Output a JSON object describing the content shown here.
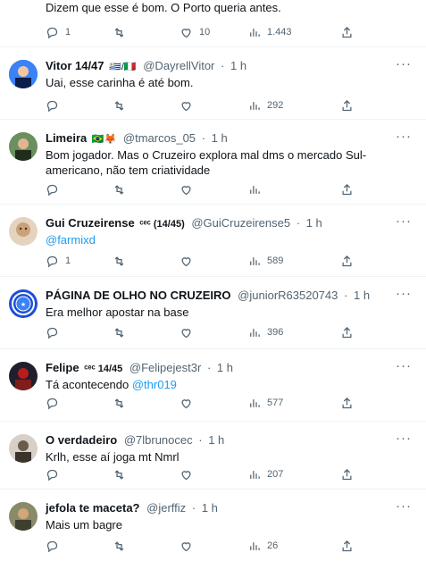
{
  "tweets": [
    {
      "name": "",
      "badge": "",
      "handle": "",
      "time": "",
      "text": "Dizem que esse é bom. O Porto queria antes.",
      "text_link": "",
      "replies": "1",
      "retweets": "",
      "likes": "10",
      "views": "1.443",
      "avatar_color": "#1e3a8a"
    },
    {
      "name": "Vitor 14/47",
      "badge": "🇺🇾/🇮🇹",
      "handle": "@DayrellVitor",
      "time": "1 h",
      "text": "Uai, esse carinha é até bom.",
      "text_link": "",
      "replies": "",
      "retweets": "",
      "likes": "",
      "views": "292",
      "avatar_color": "#2563eb"
    },
    {
      "name": "Limeira",
      "badge": "🇧🇷🦊",
      "handle": "@tmarcos_05",
      "time": "1 h",
      "text": "Bom jogador. Mas o Cruzeiro explora mal dms o mercado Sul-americano, não tem criatividade",
      "text_link": "",
      "replies": "",
      "retweets": "",
      "likes": "",
      "views": "",
      "avatar_color": "#3f6e3a"
    },
    {
      "name": "Gui Cruzeirense",
      "badge": "ᶜᵉᶜ (14/45)",
      "handle": "@GuiCruzeirense5",
      "time": "1 h",
      "text": "",
      "text_link": "@farmixd",
      "replies": "1",
      "retweets": "",
      "likes": "",
      "views": "589",
      "avatar_color": "#c9a27a"
    },
    {
      "name": "PÁGINA DE OLHO NO CRUZEIRO",
      "badge": "",
      "handle": "@juniorR63520743",
      "time": "1 h",
      "text": "Era melhor apostar na base",
      "text_link": "",
      "replies": "",
      "retweets": "",
      "likes": "",
      "views": "396",
      "avatar_color": "#1d4ed8"
    },
    {
      "name": "Felipe",
      "badge": "ᶜᵉᶜ 14/45",
      "handle": "@Felipejest3r",
      "time": "1 h",
      "text": "Tá acontecendo ",
      "text_link": "@thr019",
      "replies": "",
      "retweets": "",
      "likes": "",
      "views": "577",
      "avatar_color": "#7f1d1d"
    },
    {
      "name": "O verdadeiro",
      "badge": "",
      "handle": "@7lbrunocec",
      "time": "1 h",
      "text": "Krlh, esse aí joga mt Nmrl",
      "text_link": "",
      "replies": "",
      "retweets": "",
      "likes": "",
      "views": "207",
      "avatar_color": "#6b5b4b"
    },
    {
      "name": "jefola te maceta?",
      "badge": "",
      "handle": "@jerffiz",
      "time": "1 h",
      "text": "Mais um bagre",
      "text_link": "",
      "replies": "",
      "retweets": "",
      "likes": "",
      "views": "26",
      "avatar_color": "#4b4b3a"
    }
  ],
  "icons": {
    "reply": "reply-icon",
    "retweet": "retweet-icon",
    "like": "like-icon",
    "views": "views-icon",
    "share": "share-icon",
    "more": "more-icon"
  },
  "colors": {
    "text": "#0f1419",
    "secondary": "#536471",
    "link": "#1d9bf0",
    "divider": "#eff3f4"
  }
}
